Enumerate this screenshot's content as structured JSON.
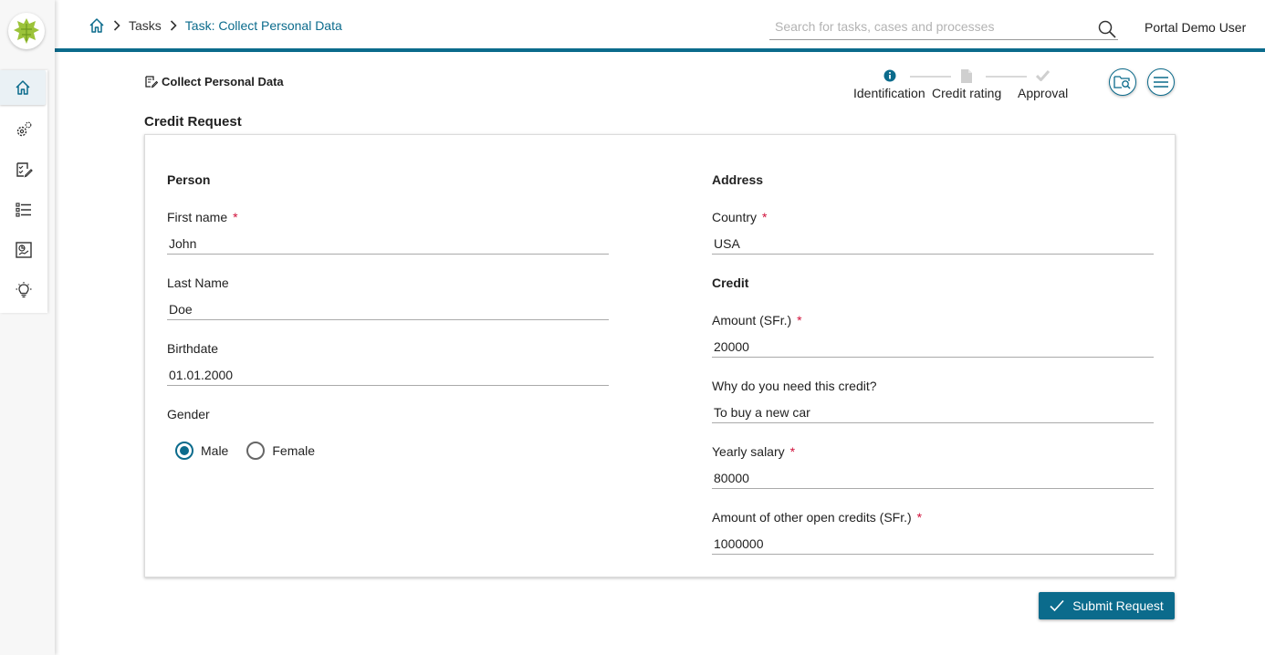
{
  "header": {
    "breadcrumb": {
      "home_icon": "home-icon",
      "tasks": "Tasks",
      "current": "Task: Collect Personal Data"
    },
    "search": {
      "placeholder": "Search for tasks, cases and processes",
      "value": ""
    },
    "user": "Portal Demo User"
  },
  "sidebar": {
    "items": [
      {
        "icon": "home-icon",
        "active": true
      },
      {
        "icon": "processes-gear-icon"
      },
      {
        "icon": "tasks-icon"
      },
      {
        "icon": "cases-list-icon"
      },
      {
        "icon": "statistics-icon"
      },
      {
        "icon": "ideas-lightbulb-icon"
      }
    ]
  },
  "task": {
    "title": "Collect Personal Data",
    "steps": [
      {
        "label": "Identification",
        "state": "current"
      },
      {
        "label": "Credit rating",
        "state": "pending"
      },
      {
        "label": "Approval",
        "state": "pending"
      }
    ]
  },
  "form": {
    "title": "Credit Request",
    "person": {
      "heading": "Person",
      "first_name": {
        "label": "First name",
        "required": "*",
        "value": "John"
      },
      "last_name": {
        "label": "Last Name",
        "value": "Doe"
      },
      "birthdate": {
        "label": "Birthdate",
        "value": "01.01.2000"
      },
      "gender": {
        "label": "Gender",
        "options": [
          "Male",
          "Female"
        ],
        "selected": "Male"
      }
    },
    "address": {
      "heading": "Address",
      "country": {
        "label": "Country",
        "required": "*",
        "value": "USA"
      }
    },
    "credit": {
      "heading": "Credit",
      "amount": {
        "label": "Amount (SFr.)",
        "required": "*",
        "value": "20000"
      },
      "reason": {
        "label": "Why do you need this credit?",
        "value": "To buy a new car"
      },
      "salary": {
        "label": "Yearly salary",
        "required": "*",
        "value": "80000"
      },
      "other_credits": {
        "label": "Amount of other open credits (SFr.)",
        "required": "*",
        "value": "1000000"
      }
    },
    "submit_label": "Submit Request"
  },
  "colors": {
    "accent": "#0b6b8c",
    "required": "#d0103a"
  }
}
